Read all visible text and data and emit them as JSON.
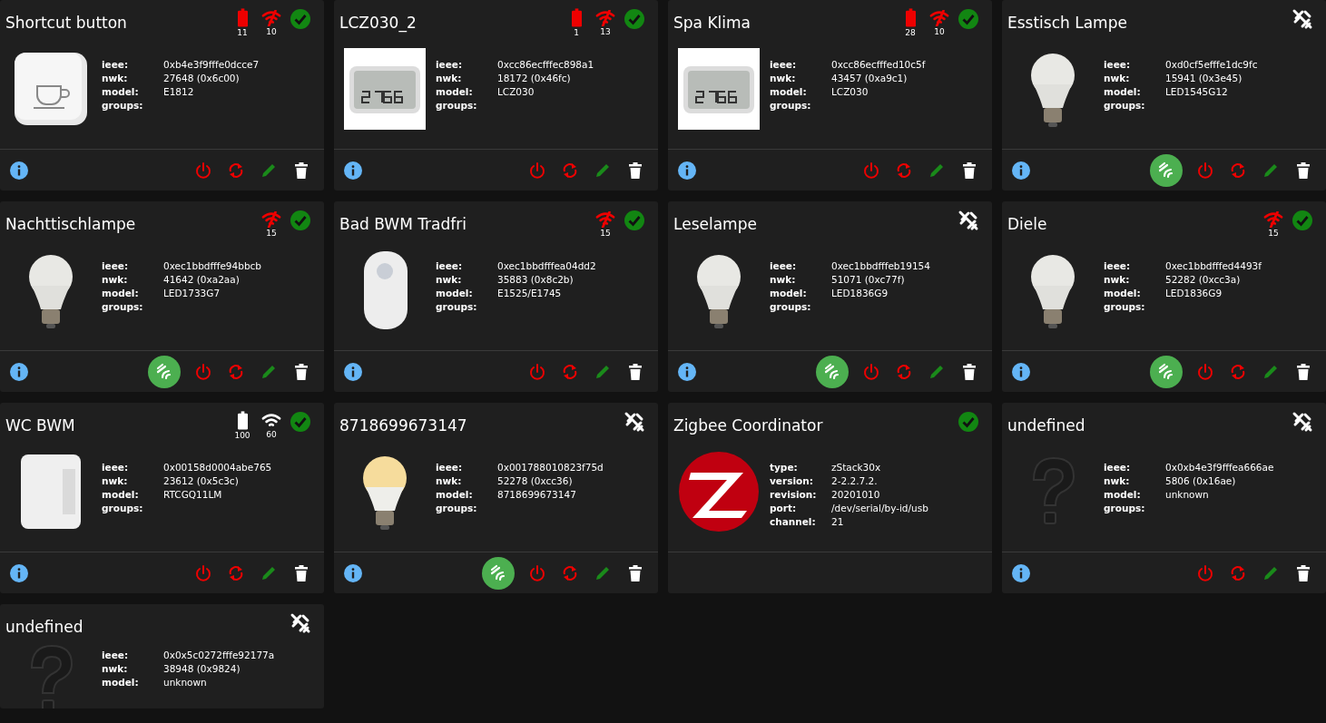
{
  "cards": [
    {
      "name": "Shortcut button",
      "battery": {
        "reading": "11",
        "low": true
      },
      "link": {
        "reading": "10",
        "low": true
      },
      "connected": true,
      "kind": "button",
      "info": [
        {
          "label": "ieee:",
          "value": "0xb4e3f9fffe0dcce7"
        },
        {
          "label": "nwk:",
          "value": "27648 (0x6c00)"
        },
        {
          "label": "model:",
          "value": "E1812"
        },
        {
          "label": "groups:"
        }
      ],
      "footer": true,
      "actions": true,
      "ping": false
    },
    {
      "name": "LCZ030_2",
      "battery": {
        "reading": "1",
        "low": true
      },
      "link": {
        "reading": "13",
        "low": true
      },
      "connected": true,
      "kind": "thermometer",
      "info": [
        {
          "label": "ieee:",
          "value": "0xcc86ecfffec898a1"
        },
        {
          "label": "nwk:",
          "value": "18172 (0x46fc)"
        },
        {
          "label": "model:",
          "value": "LCZ030"
        },
        {
          "label": "groups:"
        }
      ],
      "footer": true,
      "actions": true,
      "ping": false
    },
    {
      "name": "Spa Klima",
      "battery": {
        "reading": "28",
        "low": true
      },
      "link": {
        "reading": "10",
        "low": true
      },
      "connected": true,
      "kind": "thermometer",
      "info": [
        {
          "label": "ieee:",
          "value": "0xcc86ecfffed10c5f"
        },
        {
          "label": "nwk:",
          "value": "43457 (0xa9c1)"
        },
        {
          "label": "model:",
          "value": "LCZ030"
        },
        {
          "label": "groups:"
        }
      ],
      "footer": true,
      "actions": true,
      "ping": false
    },
    {
      "name": "Esstisch Lampe",
      "connected": false,
      "kind": "bulb",
      "info": [
        {
          "label": "ieee:",
          "value": "0xd0cf5efffe1dc9fc"
        },
        {
          "label": "nwk:",
          "value": "15941 (0x3e45)"
        },
        {
          "label": "model:",
          "value": "LED1545G12"
        },
        {
          "label": "groups:"
        }
      ],
      "footer": true,
      "actions": true,
      "ping": true
    },
    {
      "name": "Nachttischlampe",
      "link": {
        "reading": "15",
        "low": true
      },
      "connected": true,
      "kind": "bulb",
      "info": [
        {
          "label": "ieee:",
          "value": "0xec1bbdfffe94bbcb"
        },
        {
          "label": "nwk:",
          "value": "41642 (0xa2aa)"
        },
        {
          "label": "model:",
          "value": "LED1733G7"
        },
        {
          "label": "groups:"
        }
      ],
      "footer": true,
      "actions": true,
      "ping": true
    },
    {
      "name": "Bad BWM Tradfri",
      "link": {
        "reading": "15",
        "low": true
      },
      "connected": true,
      "kind": "motion",
      "info": [
        {
          "label": "ieee:",
          "value": "0xec1bbdfffea04dd2"
        },
        {
          "label": "nwk:",
          "value": "35883 (0x8c2b)"
        },
        {
          "label": "model:",
          "value": "E1525/E1745"
        },
        {
          "label": "groups:"
        }
      ],
      "footer": true,
      "actions": true,
      "ping": false
    },
    {
      "name": "Leselampe",
      "connected": false,
      "kind": "bulb",
      "info": [
        {
          "label": "ieee:",
          "value": "0xec1bbdfffeb19154"
        },
        {
          "label": "nwk:",
          "value": "51071 (0xc77f)"
        },
        {
          "label": "model:",
          "value": "LED1836G9"
        },
        {
          "label": "groups:"
        }
      ],
      "footer": true,
      "actions": true,
      "ping": true
    },
    {
      "name": "Diele",
      "link": {
        "reading": "15",
        "low": true
      },
      "connected": true,
      "kind": "bulb",
      "info": [
        {
          "label": "ieee:",
          "value": "0xec1bbdfffed4493f"
        },
        {
          "label": "nwk:",
          "value": "52282 (0xcc3a)"
        },
        {
          "label": "model:",
          "value": "LED1836G9"
        },
        {
          "label": "groups:"
        }
      ],
      "footer": true,
      "actions": true,
      "ping": true
    },
    {
      "name": "WC BWM",
      "battery": {
        "reading": "100",
        "low": false
      },
      "link": {
        "reading": "60",
        "low": false
      },
      "connected": true,
      "kind": "cylinder",
      "info": [
        {
          "label": "ieee:",
          "value": "0x00158d0004abe765"
        },
        {
          "label": "nwk:",
          "value": "23612 (0x5c3c)"
        },
        {
          "label": "model:",
          "value": "RTCGQ11LM"
        },
        {
          "label": "groups:"
        }
      ],
      "footer": true,
      "actions": true,
      "ping": false
    },
    {
      "name": "8718699673147",
      "connected": false,
      "kind": "warm-bulb",
      "info": [
        {
          "label": "ieee:",
          "value": "0x001788010823f75d"
        },
        {
          "label": "nwk:",
          "value": "52278 (0xcc36)"
        },
        {
          "label": "model:",
          "value": "8718699673147"
        },
        {
          "label": "groups:"
        }
      ],
      "footer": true,
      "actions": true,
      "ping": true
    },
    {
      "name": "Zigbee Coordinator",
      "connected": true,
      "kind": "coordinator",
      "info": [
        {
          "label": "type:",
          "value": "zStack30x"
        },
        {
          "label": "version:",
          "value": "2-2.2.7.2."
        },
        {
          "label": "revision:",
          "value": "20201010"
        },
        {
          "label": "port:",
          "value": "/dev/serial/by-id/usb"
        },
        {
          "label": "channel:",
          "value": "21"
        }
      ],
      "footer": true,
      "actions": false,
      "ping": false
    },
    {
      "name": "undefined",
      "connected": false,
      "kind": "unknown",
      "info": [
        {
          "label": "ieee:",
          "value": "0x0xb4e3f9fffea666ae"
        },
        {
          "label": "nwk:",
          "value": "5806 (0x16ae)"
        },
        {
          "label": "model:",
          "value": "unknown"
        },
        {
          "label": "groups:"
        }
      ],
      "footer": true,
      "actions": true,
      "ping": false
    },
    {
      "name": "undefined",
      "connected": false,
      "kind": "unknown",
      "info": [
        {
          "label": "ieee:",
          "value": "0x0x5c0272fffe92177a"
        },
        {
          "label": "nwk:",
          "value": "38948 (0x9824)"
        },
        {
          "label": "model:",
          "value": "unknown"
        }
      ],
      "footer": false
    }
  ]
}
